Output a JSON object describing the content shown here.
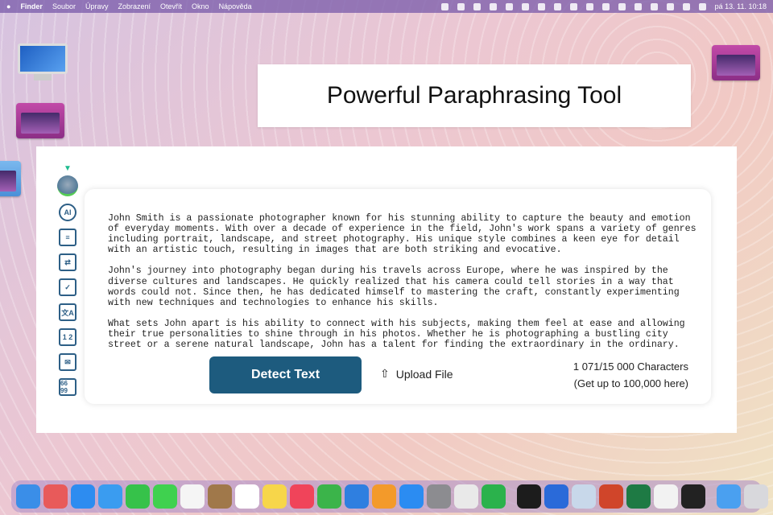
{
  "menubar": {
    "apple": "",
    "items": [
      "Finder",
      "Soubor",
      "Úpravy",
      "Zobrazení",
      "Otevřít",
      "Okno",
      "Nápověda"
    ],
    "clock": "pá 13. 11. 10:18"
  },
  "title": "Powerful Paraphrasing Tool",
  "sidebar": {
    "icons": [
      "filter-icon",
      "brain-icon",
      "ai-chat-icon",
      "checklist-icon",
      "workflow-icon",
      "document-check-icon",
      "translate-icon",
      "number-icon",
      "email-sparkle-icon",
      "quote-icon"
    ],
    "labels": {
      "ai": "AI",
      "translate": "文A",
      "numbers": "1 2",
      "quote": "66 99"
    }
  },
  "editor": {
    "paragraphs": [
      "John Smith is a passionate photographer known for his stunning ability to capture the beauty and emotion of everyday moments. With over a decade of experience in the field, John's work spans a variety of genres including portrait, landscape, and street photography. His unique style combines a keen eye for detail with an artistic touch, resulting in images that are both striking and evocative.",
      "John's journey into photography began during his travels across Europe, where he was inspired by the diverse cultures and landscapes. He quickly realized that his camera could tell stories in a way that words could not. Since then, he has dedicated himself to mastering the craft, constantly experimenting with new techniques and technologies to enhance his skills.",
      "What sets John apart is his ability to connect with his subjects, making them feel at ease and allowing their true personalities to shine through in his photos. Whether he is photographing a bustling city street or a serene natural landscape, John has a talent for finding the extraordinary in the ordinary."
    ],
    "detect_label": "Detect Text",
    "upload_label": "Upload File",
    "char_count": "1 071/15 000 Characters",
    "upgrade": "(Get up to 100,000 here)"
  },
  "colors": {
    "accent": "#1d5b7e"
  },
  "dock": [
    {
      "name": "finder",
      "color": "#3a8ee8"
    },
    {
      "name": "launchpad",
      "color": "#e85a5a"
    },
    {
      "name": "safari",
      "color": "#2d8cf0"
    },
    {
      "name": "mail",
      "color": "#3a9cf0"
    },
    {
      "name": "facetime",
      "color": "#36c24a"
    },
    {
      "name": "messages",
      "color": "#3fd14f"
    },
    {
      "name": "photos",
      "color": "#f5f5f5"
    },
    {
      "name": "contacts",
      "color": "#a0784a"
    },
    {
      "name": "reminders",
      "color": "#ffffff"
    },
    {
      "name": "notes",
      "color": "#f7d64a"
    },
    {
      "name": "music",
      "color": "#f0445a"
    },
    {
      "name": "numbers",
      "color": "#3bb44a"
    },
    {
      "name": "keynote",
      "color": "#2f7fe0"
    },
    {
      "name": "pages",
      "color": "#f39a2a"
    },
    {
      "name": "app-store",
      "color": "#2b8cf2"
    },
    {
      "name": "system-preferences",
      "color": "#8c8c90"
    },
    {
      "name": "chrome",
      "color": "#e9e9e9"
    },
    {
      "name": "feedly",
      "color": "#2bb24c"
    },
    {
      "name": "spotify",
      "color": "#1c1c1c"
    },
    {
      "name": "teamviewer",
      "color": "#2a6ad9"
    },
    {
      "name": "preview",
      "color": "#c8d8ea"
    },
    {
      "name": "powerpoint",
      "color": "#d0452a"
    },
    {
      "name": "excel",
      "color": "#1e7a44"
    },
    {
      "name": "script-editor",
      "color": "#f2f2f2"
    },
    {
      "name": "terminal",
      "color": "#222222"
    },
    {
      "name": "downloads",
      "color": "#4aa0f0"
    },
    {
      "name": "trash",
      "color": "#d8d8dc"
    }
  ]
}
